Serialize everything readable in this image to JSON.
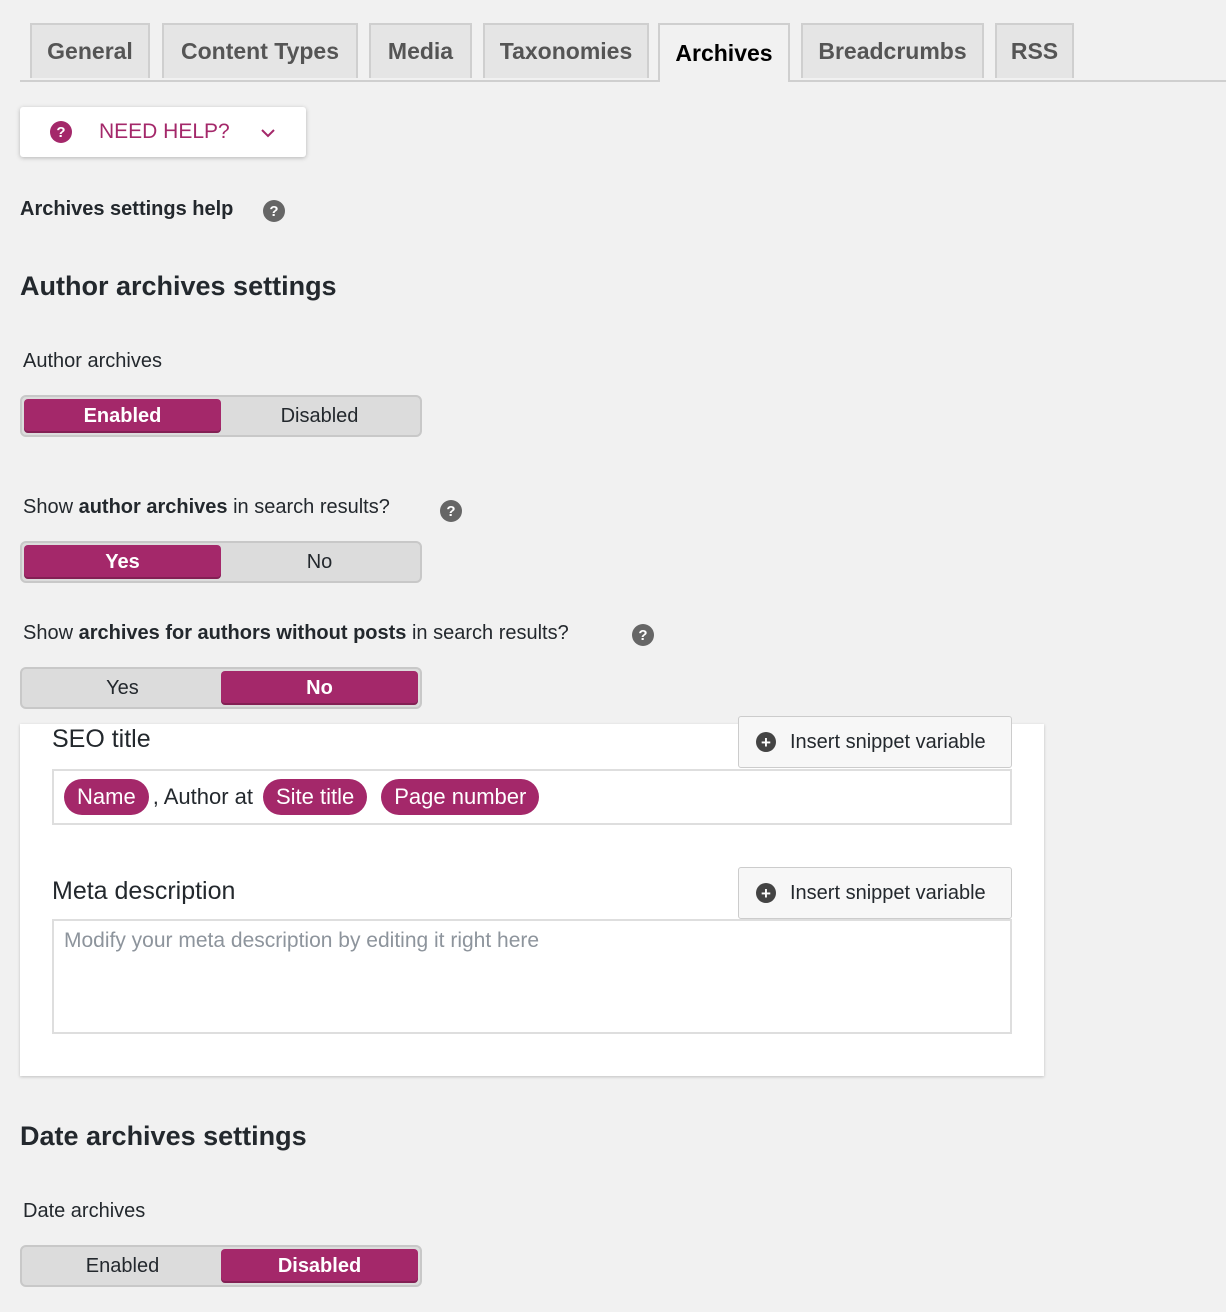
{
  "tabs": [
    {
      "label": "General"
    },
    {
      "label": "Content Types"
    },
    {
      "label": "Media"
    },
    {
      "label": "Taxonomies"
    },
    {
      "label": "Archives",
      "active": true
    },
    {
      "label": "Breadcrumbs"
    },
    {
      "label": "RSS"
    }
  ],
  "need_help": {
    "label": "NEED HELP?",
    "icon": "question-circle-icon",
    "chevron": "chevron-down-icon"
  },
  "archives_help": {
    "label": "Archives settings help"
  },
  "author_section": {
    "heading": "Author archives settings",
    "author_archives": {
      "label": "Author archives",
      "options": [
        "Enabled",
        "Disabled"
      ],
      "selected": "Enabled"
    },
    "show_in_search": {
      "prefix": "Show ",
      "bold": "author archives",
      "suffix": " in search results?",
      "options": [
        "Yes",
        "No"
      ],
      "selected": "Yes"
    },
    "without_posts": {
      "prefix": "Show ",
      "bold": "archives for authors without posts",
      "suffix": " in search results?",
      "options": [
        "Yes",
        "No"
      ],
      "selected": "No"
    }
  },
  "seo_title": {
    "label": "SEO title",
    "insert_label": "Insert snippet variable",
    "tokens": {
      "name": "Name",
      "text": ", Author at",
      "site_title": "Site title",
      "page_number": "Page number"
    }
  },
  "meta_description": {
    "label": "Meta description",
    "insert_label": "Insert snippet variable",
    "placeholder": "Modify your meta description by editing it right here"
  },
  "date_section": {
    "heading": "Date archives settings",
    "date_archives": {
      "label": "Date archives",
      "options": [
        "Enabled",
        "Disabled"
      ],
      "selected": "Disabled"
    }
  },
  "colors": {
    "accent": "#a4286a",
    "background": "#f1f1f1"
  }
}
